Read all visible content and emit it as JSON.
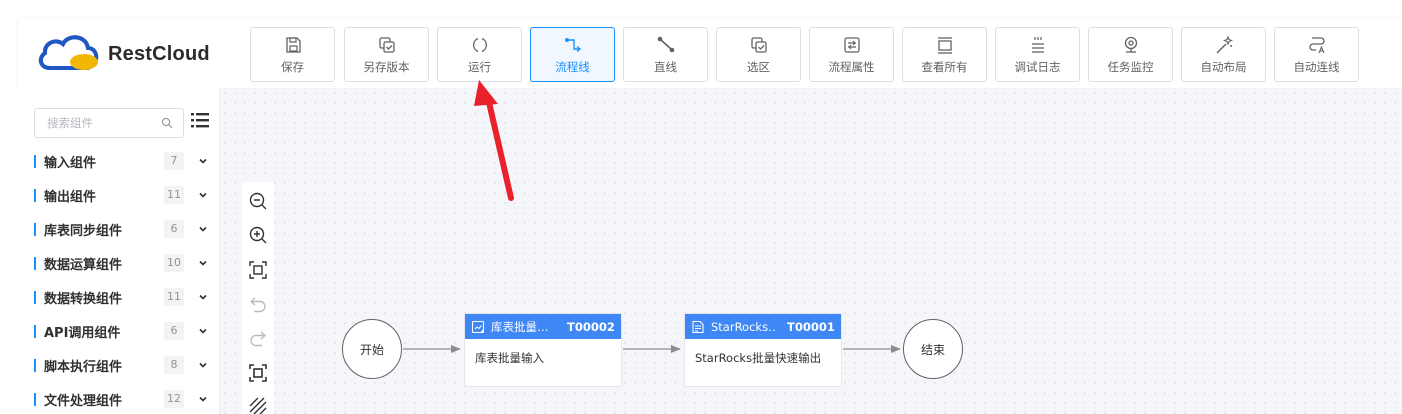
{
  "app": {
    "logo_text": "RestCloud"
  },
  "colors": {
    "accent": "#1890ff",
    "node_header": "#3f87f5",
    "annotation_arrow": "#e8212b"
  },
  "toolbar": {
    "buttons": [
      {
        "label": "保存",
        "icon": "save-icon"
      },
      {
        "label": "另存版本",
        "icon": "save-version-icon"
      },
      {
        "label": "运行",
        "icon": "run-icon"
      },
      {
        "label": "流程线",
        "icon": "flow-line-icon",
        "active": true
      },
      {
        "label": "直线",
        "icon": "straight-line-icon"
      },
      {
        "label": "选区",
        "icon": "select-area-icon"
      },
      {
        "label": "流程属性",
        "icon": "flow-properties-icon"
      },
      {
        "label": "查看所有",
        "icon": "view-all-icon"
      },
      {
        "label": "调试日志",
        "icon": "debug-log-icon"
      },
      {
        "label": "任务监控",
        "icon": "task-monitor-icon"
      },
      {
        "label": "自动布局",
        "icon": "auto-layout-icon"
      },
      {
        "label": "自动连线",
        "icon": "auto-connect-icon"
      }
    ]
  },
  "sidebar": {
    "search_placeholder": "搜索组件",
    "categories": [
      {
        "label": "输入组件",
        "count": "7"
      },
      {
        "label": "输出组件",
        "count": "11"
      },
      {
        "label": "库表同步组件",
        "count": "6"
      },
      {
        "label": "数据运算组件",
        "count": "10"
      },
      {
        "label": "数据转换组件",
        "count": "11"
      },
      {
        "label": "API调用组件",
        "count": "6"
      },
      {
        "label": "脚本执行组件",
        "count": "8"
      },
      {
        "label": "文件处理组件",
        "count": "12"
      }
    ]
  },
  "canvas": {
    "zoom_tools": [
      "zoom-out-icon",
      "zoom-in-icon",
      "fit-view-icon",
      "undo-icon",
      "redo-icon",
      "fullscreen-icon",
      "grid-toggle-icon"
    ],
    "start_node": {
      "label": "开始"
    },
    "end_node": {
      "label": "结束"
    },
    "tasks": [
      {
        "title": "库表批量…",
        "code": "T00002",
        "body": "库表批量输入"
      },
      {
        "title": "StarRocks…",
        "code": "T00001",
        "body": "StarRocks批量快速输出"
      }
    ]
  }
}
